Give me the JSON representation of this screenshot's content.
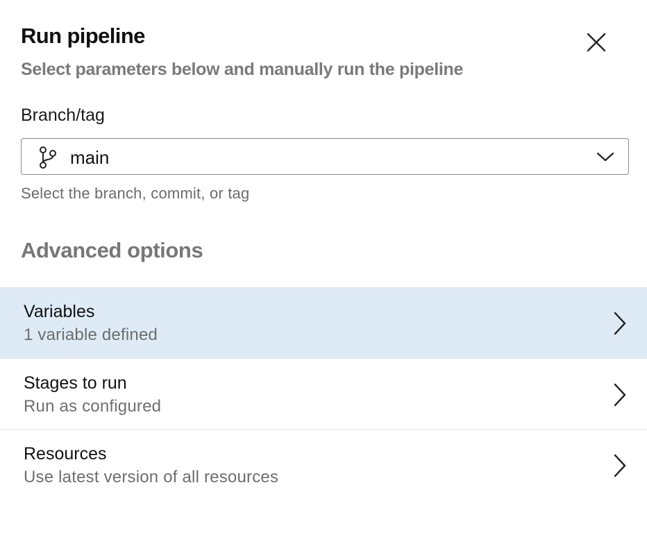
{
  "dialog": {
    "title": "Run pipeline",
    "subtitle": "Select parameters below and manually run the pipeline",
    "close_icon": "close-icon"
  },
  "branch": {
    "label": "Branch/tag",
    "value": "main",
    "icon": "git-branch-icon",
    "helper": "Select the branch, commit, or tag"
  },
  "advanced": {
    "heading": "Advanced options",
    "items": [
      {
        "title": "Variables",
        "subtitle": "1 variable defined",
        "selected": true
      },
      {
        "title": "Stages to run",
        "subtitle": "Run as configured",
        "selected": false
      },
      {
        "title": "Resources",
        "subtitle": "Use latest version of all resources",
        "selected": false
      }
    ]
  },
  "colors": {
    "selected_row": "#deebf7",
    "subtitle_text": "#7a7a7a"
  }
}
